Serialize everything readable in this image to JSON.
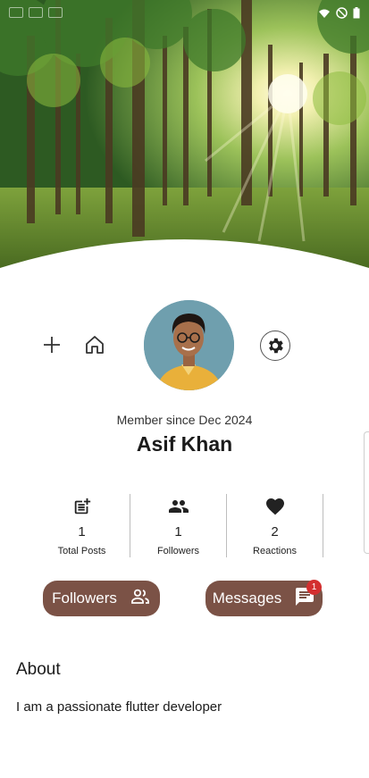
{
  "profile": {
    "member_since": "Member since Dec 2024",
    "name": "Asif Khan"
  },
  "stats": [
    {
      "icon": "post-add-icon",
      "value": "1",
      "label": "Total Posts"
    },
    {
      "icon": "people-icon",
      "value": "1",
      "label": "Followers"
    },
    {
      "icon": "heart-icon",
      "value": "2",
      "label": "Reactions"
    }
  ],
  "buttons": {
    "followers_label": "Followers",
    "messages_label": "Messages",
    "messages_badge": "1"
  },
  "about": {
    "title": "About",
    "text": "I am a passionate flutter developer"
  },
  "colors": {
    "pill_background": "#7b5246",
    "badge": "#d32f2f"
  }
}
